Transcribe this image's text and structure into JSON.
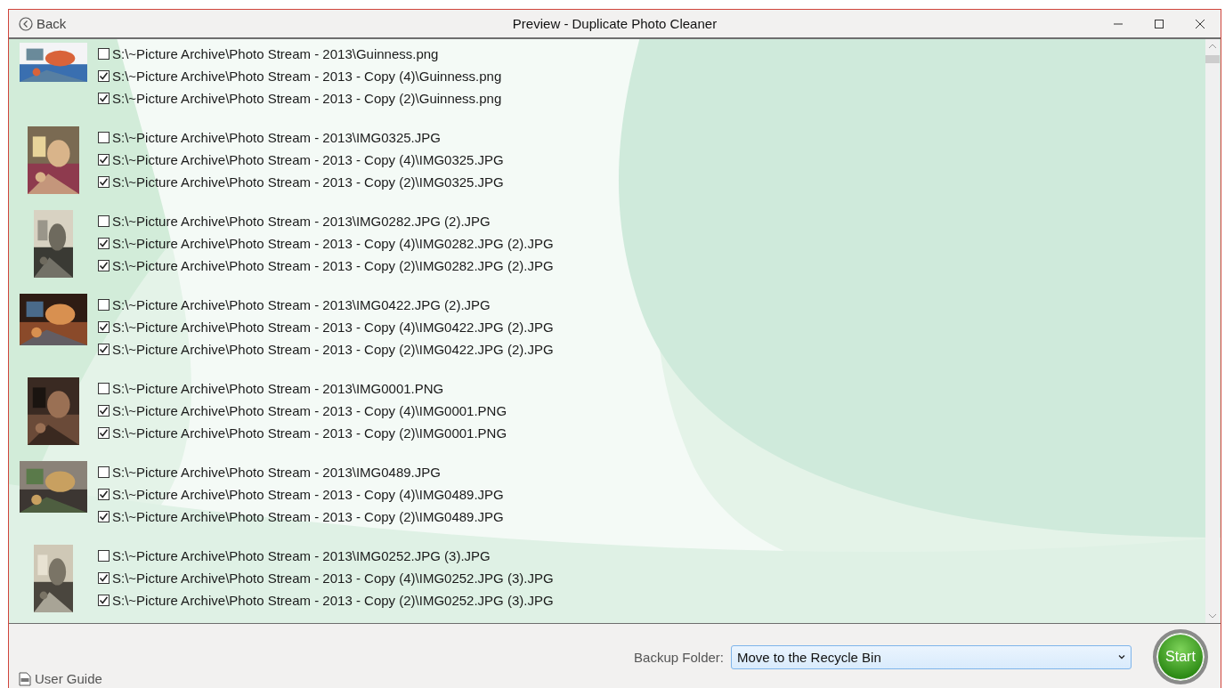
{
  "window": {
    "title": "Preview - Duplicate Photo Cleaner",
    "back": "Back"
  },
  "groups": [
    {
      "files": [
        {
          "path": "S:\\~Picture Archive\\Photo Stream - 2013\\Guinness.png",
          "checked": false
        },
        {
          "path": "S:\\~Picture Archive\\Photo Stream - 2013 - Copy (4)\\Guinness.png",
          "checked": true
        },
        {
          "path": "S:\\~Picture Archive\\Photo Stream - 2013 - Copy (2)\\Guinness.png",
          "checked": true
        }
      ]
    },
    {
      "files": [
        {
          "path": "S:\\~Picture Archive\\Photo Stream - 2013\\IMG0325.JPG",
          "checked": false
        },
        {
          "path": "S:\\~Picture Archive\\Photo Stream - 2013 - Copy (4)\\IMG0325.JPG",
          "checked": true
        },
        {
          "path": "S:\\~Picture Archive\\Photo Stream - 2013 - Copy (2)\\IMG0325.JPG",
          "checked": true
        }
      ]
    },
    {
      "files": [
        {
          "path": "S:\\~Picture Archive\\Photo Stream - 2013\\IMG0282.JPG (2).JPG",
          "checked": false
        },
        {
          "path": "S:\\~Picture Archive\\Photo Stream - 2013 - Copy (4)\\IMG0282.JPG (2).JPG",
          "checked": true
        },
        {
          "path": "S:\\~Picture Archive\\Photo Stream - 2013 - Copy (2)\\IMG0282.JPG (2).JPG",
          "checked": true
        }
      ]
    },
    {
      "files": [
        {
          "path": "S:\\~Picture Archive\\Photo Stream - 2013\\IMG0422.JPG (2).JPG",
          "checked": false
        },
        {
          "path": "S:\\~Picture Archive\\Photo Stream - 2013 - Copy (4)\\IMG0422.JPG (2).JPG",
          "checked": true
        },
        {
          "path": "S:\\~Picture Archive\\Photo Stream - 2013 - Copy (2)\\IMG0422.JPG (2).JPG",
          "checked": true
        }
      ]
    },
    {
      "files": [
        {
          "path": "S:\\~Picture Archive\\Photo Stream - 2013\\IMG0001.PNG",
          "checked": false
        },
        {
          "path": "S:\\~Picture Archive\\Photo Stream - 2013 - Copy (4)\\IMG0001.PNG",
          "checked": true
        },
        {
          "path": "S:\\~Picture Archive\\Photo Stream - 2013 - Copy (2)\\IMG0001.PNG",
          "checked": true
        }
      ]
    },
    {
      "files": [
        {
          "path": "S:\\~Picture Archive\\Photo Stream - 2013\\IMG0489.JPG",
          "checked": false
        },
        {
          "path": "S:\\~Picture Archive\\Photo Stream - 2013 - Copy (4)\\IMG0489.JPG",
          "checked": true
        },
        {
          "path": "S:\\~Picture Archive\\Photo Stream - 2013 - Copy (2)\\IMG0489.JPG",
          "checked": true
        }
      ]
    },
    {
      "files": [
        {
          "path": "S:\\~Picture Archive\\Photo Stream - 2013\\IMG0252.JPG (3).JPG",
          "checked": false
        },
        {
          "path": "S:\\~Picture Archive\\Photo Stream - 2013 - Copy (4)\\IMG0252.JPG (3).JPG",
          "checked": true
        },
        {
          "path": "S:\\~Picture Archive\\Photo Stream - 2013 - Copy (2)\\IMG0252.JPG (3).JPG",
          "checked": true
        }
      ]
    }
  ],
  "footer": {
    "user_guide": "User Guide",
    "backup_label": "Backup Folder:",
    "backup_value": "Move to the Recycle Bin",
    "start": "Start"
  }
}
